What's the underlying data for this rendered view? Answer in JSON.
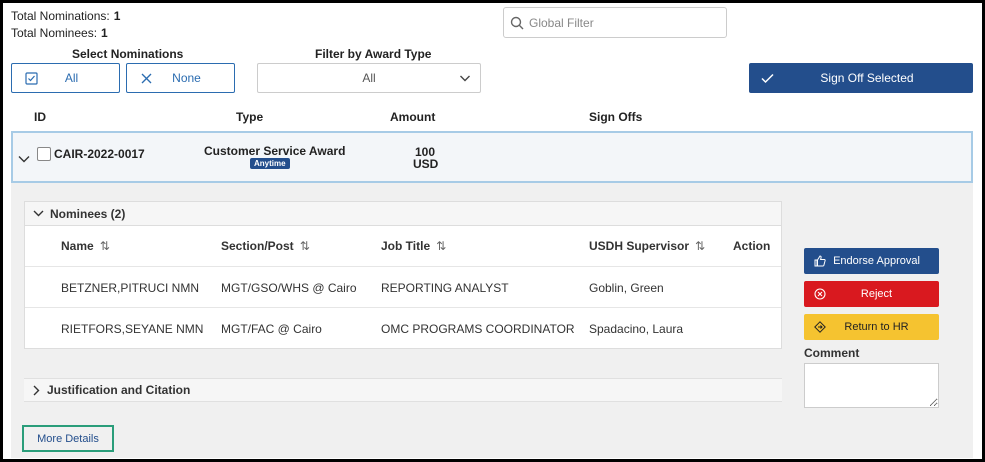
{
  "totals": {
    "nominations_label": "Total Nominations:",
    "nominations_value": "1",
    "nominees_label": "Total Nominees:",
    "nominees_value": "1"
  },
  "search": {
    "placeholder": "Global Filter"
  },
  "select_nominations": {
    "label": "Select Nominations",
    "all": "All",
    "none": "None"
  },
  "award_filter": {
    "label": "Filter by Award Type",
    "value": "All"
  },
  "signoff_button": "Sign Off Selected",
  "columns": {
    "id": "ID",
    "type": "Type",
    "amount": "Amount",
    "signoffs": "Sign Offs"
  },
  "nomination": {
    "id": "CAIR-2022-0017",
    "type": "Customer Service Award",
    "badge": "Anytime",
    "amount_value": "100",
    "amount_currency": "USD"
  },
  "nominees": {
    "header": "Nominees (2)",
    "columns": [
      "Name",
      "Section/Post",
      "Job Title",
      "USDH Supervisor",
      "Action"
    ],
    "rows": [
      {
        "name": "BETZNER,PITRUCI NMN",
        "section": "MGT/GSO/WHS @ Cairo",
        "title": "REPORTING ANALYST",
        "supervisor": "Goblin, Green"
      },
      {
        "name": "RIETFORS,SEYANE NMN",
        "section": "MGT/FAC @ Cairo",
        "title": "OMC PROGRAMS COORDINATOR",
        "supervisor": "Spadacino, Laura"
      }
    ]
  },
  "justification": "Justification and Citation",
  "actions": {
    "endorse": "Endorse Approval",
    "reject": "Reject",
    "return": "Return to HR"
  },
  "comment_label": "Comment",
  "more_details": "More Details",
  "colors": {
    "primary": "#234e8c",
    "reject": "#d9191f",
    "return": "#f5c330",
    "highlight": "#a7cbe6",
    "focus": "#2a9d7a"
  }
}
